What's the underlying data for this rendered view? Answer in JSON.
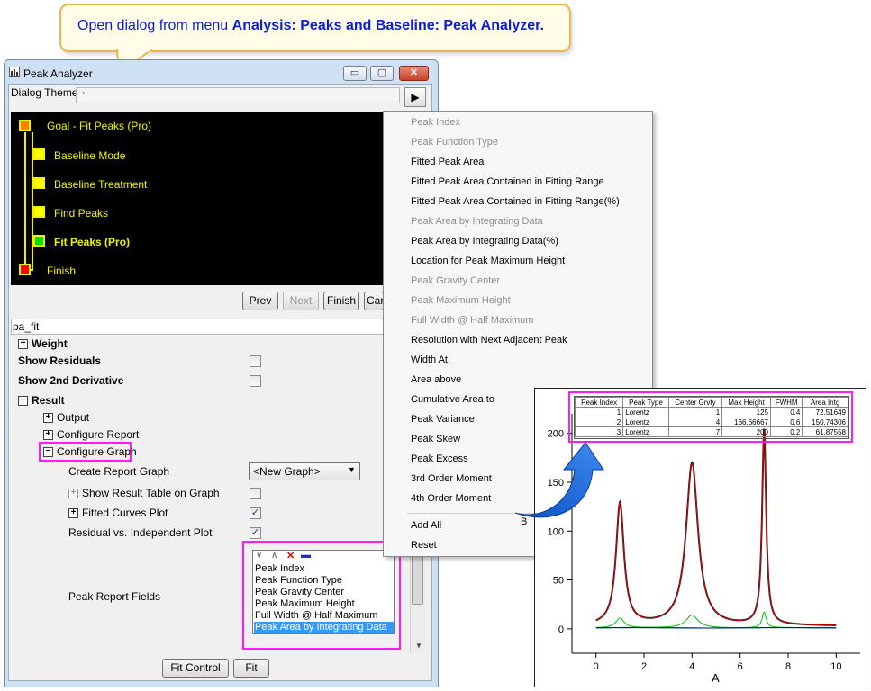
{
  "callout": {
    "prefix": "Open dialog from menu ",
    "menu_path": "Analysis: Peaks and Baseline: Peak Analyzer",
    "suffix": "."
  },
  "window": {
    "title": "Peak Analyzer",
    "minimize_glyph": "▭",
    "maximize_glyph": "▢",
    "close_glyph": "✕"
  },
  "dialog_theme": {
    "label": "Dialog Theme",
    "value": "*",
    "arrow_glyph": "▶"
  },
  "flowchart": {
    "steps": [
      {
        "label": "Goal - Fit Peaks (Pro)",
        "color": "#ff7f00",
        "bold": false
      },
      {
        "label": "Baseline Mode",
        "color": "#ffff00",
        "bold": false
      },
      {
        "label": "Baseline Treatment",
        "color": "#ffff00",
        "bold": false
      },
      {
        "label": "Find Peaks",
        "color": "#ffff00",
        "bold": false
      },
      {
        "label": "Fit Peaks (Pro)",
        "color": "#00e000",
        "bold": true
      },
      {
        "label": "Finish",
        "color": "#ff0000",
        "bold": false
      }
    ]
  },
  "nav": {
    "prev": "Prev",
    "next": "Next",
    "finish": "Finish",
    "cancel": "Cancel"
  },
  "theme_name": "pa_fit",
  "tree": {
    "weight": "Weight",
    "show_residuals": "Show Residuals",
    "show_2nd_derivative": "Show 2nd Derivative",
    "result": "Result",
    "output": "Output",
    "configure_report": "Configure Report",
    "configure_graph": "Configure Graph",
    "create_report_graph": "Create Report Graph",
    "create_report_graph_value": "<New Graph>",
    "show_result_table": "Show Result Table on Graph",
    "fitted_curves_plot": "Fitted Curves Plot",
    "residual_plot": "Residual vs. Independent Plot",
    "peak_report_fields": "Peak Report Fields",
    "expand_glyph": "+",
    "collapse_glyph": "−",
    "check_glyph": "✓",
    "dropdown_glyph": "▼"
  },
  "fields_toolbar": [
    "∨",
    "∧",
    "✕",
    "▬"
  ],
  "fields": [
    {
      "label": "Peak Index",
      "selected": false
    },
    {
      "label": "Peak Function Type",
      "selected": false
    },
    {
      "label": "Peak Gravity Center",
      "selected": false
    },
    {
      "label": "Peak Maximum Height",
      "selected": false
    },
    {
      "label": "Full Width @ Half Maximum",
      "selected": false
    },
    {
      "label": "Peak Area by Integrating Data",
      "selected": true
    }
  ],
  "menu": {
    "items": [
      {
        "label": "Peak Index",
        "enabled": false
      },
      {
        "label": "Peak Function Type",
        "enabled": false
      },
      {
        "label": "Fitted Peak Area",
        "enabled": true
      },
      {
        "label": "Fitted Peak Area Contained in Fitting Range",
        "enabled": true
      },
      {
        "label": "Fitted Peak Area Contained in Fitting Range(%)",
        "enabled": true
      },
      {
        "label": "Peak Area by Integrating Data",
        "enabled": false
      },
      {
        "label": "Peak Area by Integrating Data(%)",
        "enabled": true
      },
      {
        "label": "Location for Peak Maximum Height",
        "enabled": true
      },
      {
        "label": "Peak Gravity Center",
        "enabled": false
      },
      {
        "label": "Peak Maximum Height",
        "enabled": false
      },
      {
        "label": "Full Width @ Half Maximum",
        "enabled": false
      },
      {
        "label": "Resolution with Next Adjacent Peak",
        "enabled": true
      },
      {
        "label": "Width At",
        "enabled": true
      },
      {
        "label": "Area above",
        "enabled": true
      },
      {
        "label": "Cumulative Area to",
        "enabled": true
      },
      {
        "label": "Peak Variance",
        "enabled": true
      },
      {
        "label": "Peak Skew",
        "enabled": true
      },
      {
        "label": "Peak Excess",
        "enabled": true
      },
      {
        "label": "3rd Order Moment",
        "enabled": true
      },
      {
        "label": "4th Order Moment",
        "enabled": true
      }
    ],
    "add_all": "Add All",
    "reset": "Reset"
  },
  "bottom_buttons": {
    "fit_control": "Fit Control",
    "fit": "Fit"
  },
  "result_table": {
    "headers": [
      "Peak Index",
      "Peak Type",
      "Center Grvty",
      "Max Height",
      "FWHM",
      "Area Intg"
    ],
    "rows": [
      [
        "1",
        "Lorentz",
        "1",
        "125",
        "0.4",
        "72.51649"
      ],
      [
        "2",
        "Lorentz",
        "4",
        "166.66667",
        "0.6",
        "150.74306"
      ],
      [
        "3",
        "Lorentz",
        "7",
        "200",
        "0.2",
        "61.87558"
      ]
    ]
  },
  "chart_data": {
    "type": "line",
    "xlabel": "A",
    "ylabel": "B",
    "xlim": [
      -1,
      11
    ],
    "ylim": [
      -25,
      220
    ],
    "x_ticks": [
      "0",
      "2",
      "4",
      "6",
      "8",
      "10"
    ],
    "y_ticks": [
      "0",
      "50",
      "100",
      "150",
      "200"
    ],
    "x_tick_values": [
      0,
      2,
      4,
      6,
      8,
      10
    ],
    "y_tick_values": [
      0,
      50,
      100,
      150,
      200
    ],
    "peaks": [
      {
        "center": 1,
        "height": 125,
        "fwhm": 0.4
      },
      {
        "center": 4,
        "height": 166.67,
        "fwhm": 0.6
      },
      {
        "center": 7,
        "height": 200,
        "fwhm": 0.2
      }
    ],
    "series": [
      {
        "color": "#222222"
      },
      {
        "color": "#d40000"
      },
      {
        "color": "#00c000"
      },
      {
        "color": "#0000c0"
      }
    ],
    "x_range": [
      0,
      10
    ]
  }
}
